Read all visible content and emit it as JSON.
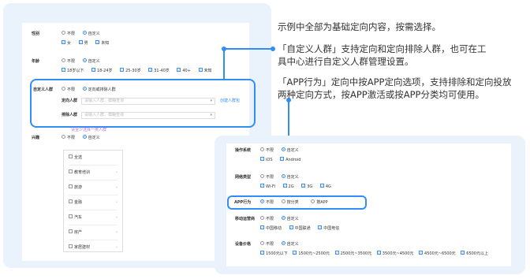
{
  "description": {
    "line1": "示例中全部为基础定向内容，按需选择。",
    "line2a": "「自定义人群」支持定向和定向排除人群，也可在工",
    "line2b": "具中心进行自定义人群管理设置。",
    "line3a": "「APP行为」定向中按APP定向选项，支持排除和定向投放",
    "line3b": "两种定向方式，按APP激活或按APP分类均可使用。"
  },
  "left_panel": {
    "gender": {
      "label": "性别",
      "opt_unlimited": "不限",
      "opt_custom": "自定义",
      "checks": [
        "女",
        "男",
        "未知"
      ]
    },
    "age": {
      "label": "年龄",
      "opt_unlimited": "不限",
      "opt_custom": "自定义",
      "checks": [
        "18岁以下",
        "18-24岁",
        "25-30岁",
        "31-40岁",
        "40+",
        "未知"
      ]
    },
    "custom_crowd": {
      "label": "自定义人群",
      "opt_unlimited": "不限",
      "opt_custom": "定向或排除人群",
      "target_label": "定向人群",
      "target_placeholder": "请输入人群、模糊查询",
      "exclude_label": "排除人群",
      "exclude_placeholder": "请输入人群、模糊查询",
      "create_link": "创建人群包",
      "hint": "请至少选择一类人群"
    },
    "interest": {
      "label": "兴趣",
      "opt_unlimited": "不限",
      "opt_custom": "自定义",
      "categories": [
        "全选",
        "教育培训",
        "旅游",
        "金融",
        "汽车",
        "房产",
        "家居建材"
      ]
    }
  },
  "right_panel": {
    "os": {
      "label": "操作系统",
      "opt_unlimited": "不限",
      "opt_custom": "自定义",
      "checks": [
        "iOS",
        "Android"
      ]
    },
    "network": {
      "label": "网络类型",
      "opt_unlimited": "不限",
      "opt_custom": "自定义",
      "checks": [
        "Wi-Fi",
        "2G",
        "3G",
        "4G"
      ]
    },
    "app": {
      "label": "APP行为",
      "opt_unlimited": "不限",
      "opt_category": "按分类",
      "opt_app": "按APP"
    },
    "carrier": {
      "label": "移动运营商",
      "opt_unlimited": "不限",
      "opt_custom": "自定义",
      "checks": [
        "中国移动",
        "中国联通",
        "中国电信"
      ]
    },
    "price": {
      "label": "设备价格",
      "opt_unlimited": "不限",
      "opt_custom": "自定义",
      "checks": [
        "1500元以下",
        "1500元~2500元",
        "2500元~3500元",
        "3500元~4500元",
        "4500元~6500元",
        "6500元以上"
      ]
    }
  },
  "colors": {
    "accent": "#2f8ff6",
    "panel_bg": "#eaf2fb"
  }
}
